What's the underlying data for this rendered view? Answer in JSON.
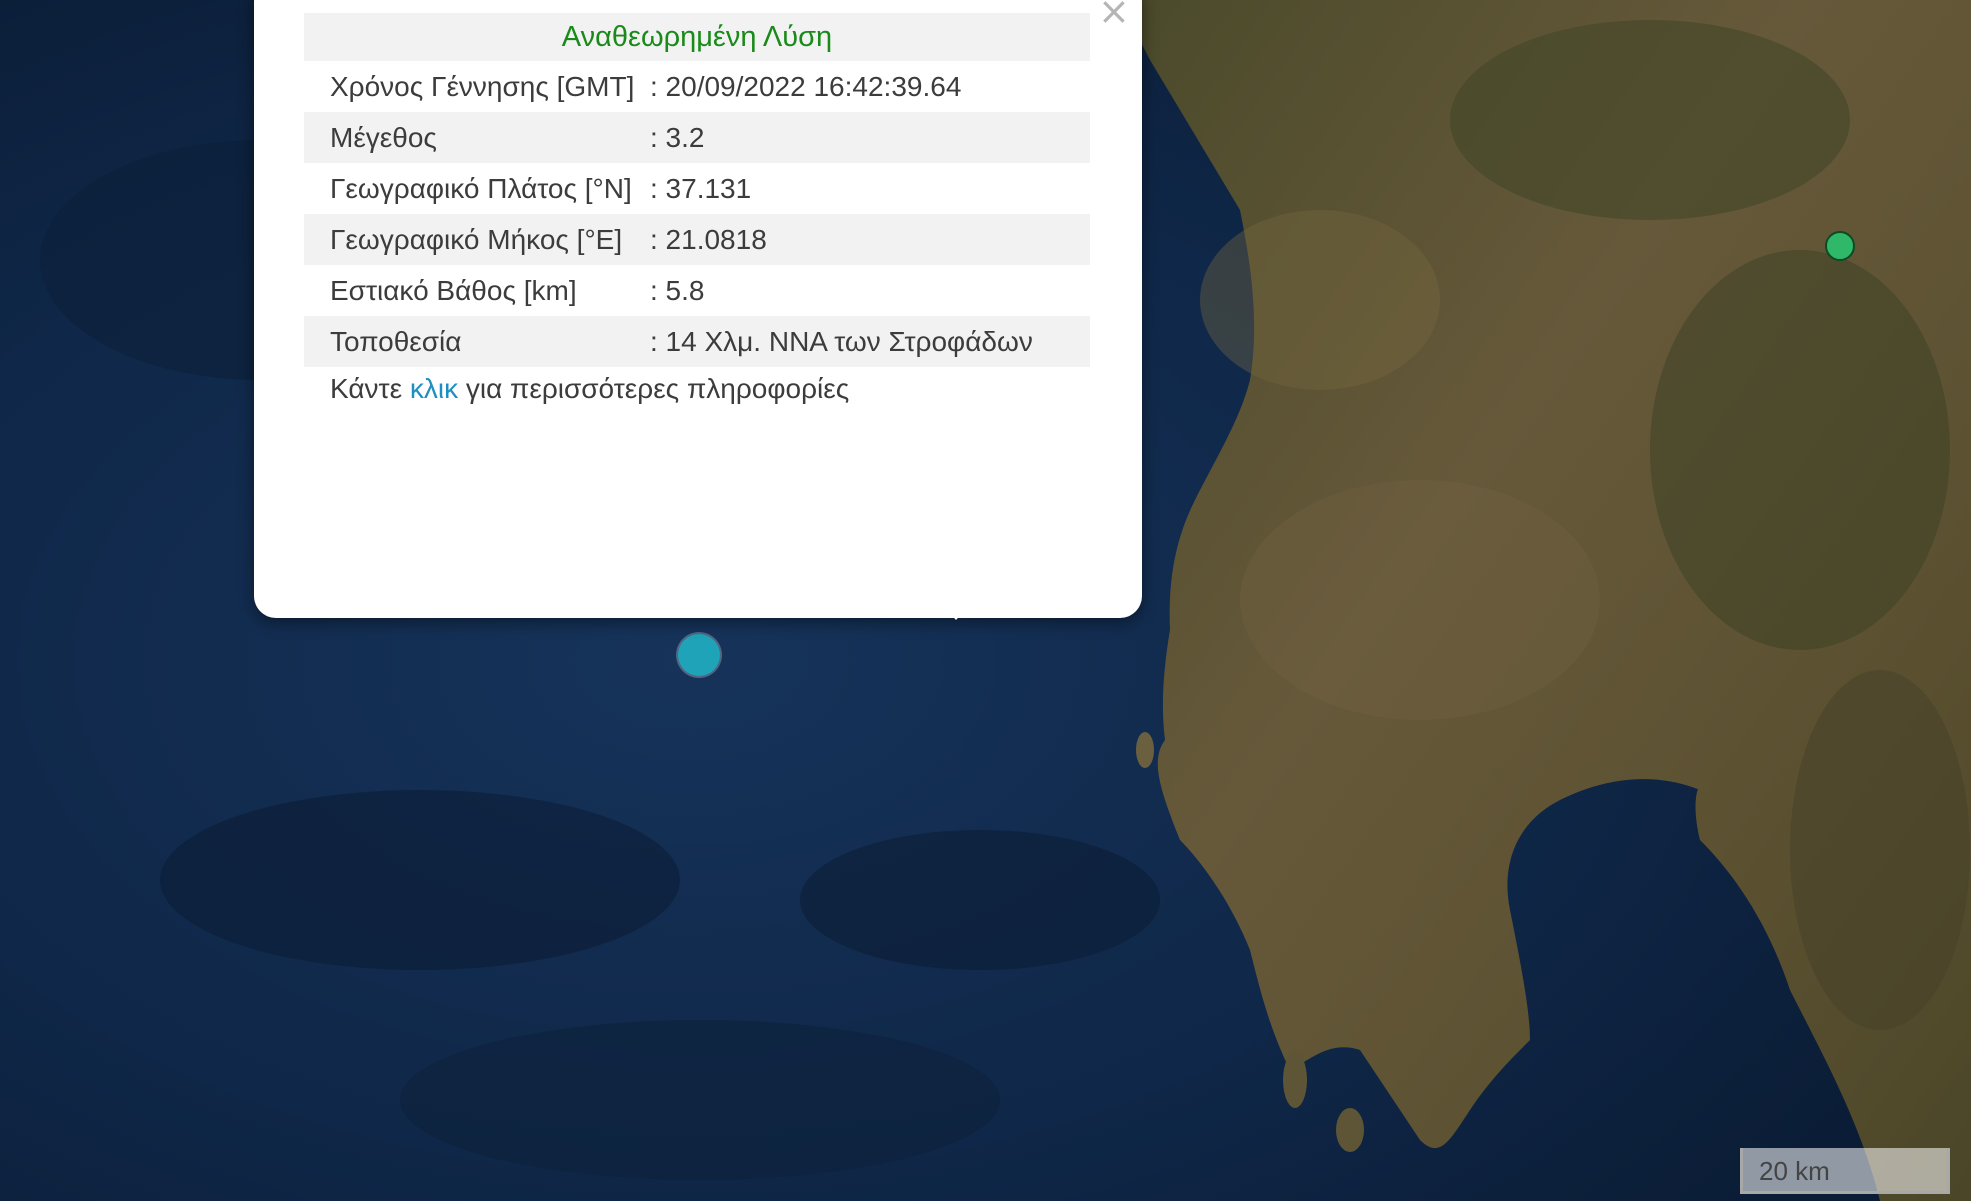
{
  "popup": {
    "title": "Αναθεωρημένη Λύση",
    "close_glyph": "×",
    "rows": [
      {
        "label": "Χρόνος Γέννησης [GMT]",
        "value": ": 20/09/2022 16:42:39.64"
      },
      {
        "label": "Μέγεθος",
        "value": ": 3.2"
      },
      {
        "label": "Γεωγραφικό Πλάτος [°N]",
        "value": ": 37.131"
      },
      {
        "label": "Γεωγραφικό Μήκος [°E]",
        "value": ": 21.0818"
      },
      {
        "label": "Εστιακό Βάθος [km]",
        "value": ": 5.8"
      },
      {
        "label": "Τοποθεσία",
        "value": ": 14 Χλμ. ΝΝΑ των Στροφάδων"
      }
    ],
    "more": {
      "prefix": "Κάντε ",
      "link": "κλικ",
      "suffix": " για περισσότερες πληροφορίες"
    }
  },
  "scale": {
    "label": "20 km"
  },
  "colors": {
    "sea": "#0f2540",
    "land": "#5a5230",
    "title_green": "#1a8a1a",
    "link_blue": "#1e8fbf",
    "selected_marker": "#1fa3b8",
    "other_marker": "#2fb868"
  }
}
